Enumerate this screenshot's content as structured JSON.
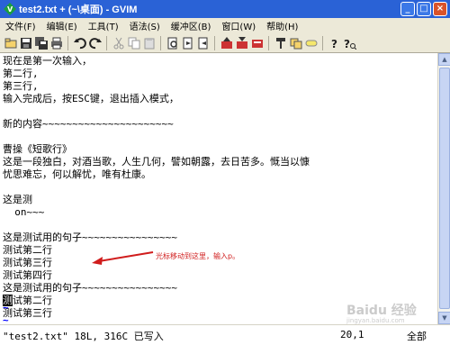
{
  "window": {
    "title": "test2.txt + (~\\桌面) - GVIM",
    "buttons": [
      "_",
      "□",
      "×"
    ]
  },
  "menu": {
    "items": [
      "文件(F)",
      "编辑(E)",
      "工具(T)",
      "语法(S)",
      "缓冲区(B)",
      "窗口(W)",
      "帮助(H)"
    ]
  },
  "toolbar": {
    "icons": [
      "open-icon",
      "save-icon",
      "save-all-icon",
      "print-icon",
      "undo-icon",
      "redo-icon",
      "cut-icon",
      "copy-icon",
      "paste-icon",
      "find-replace-icon",
      "find-next-icon",
      "find-prev-icon",
      "load-session-icon",
      "save-session-icon",
      "run-script-icon",
      "make-icon",
      "build-tags-icon",
      "jump-tag-icon",
      "help-icon",
      "find-help-icon"
    ]
  },
  "editor": {
    "lines": [
      "现在是第一次输入，",
      "第二行,",
      "第三行,",
      "输入完成后，按ESC键，退出插入模式，",
      "",
      "新的内容~~~~~~~~~~~~~~~~~~~~~~",
      "",
      "曹操《短歌行》",
      "这是一段独白，对酒当歌，人生几何，譬如朝露，去日苦多。慨当以慷",
      "忧思难忘，何以解忧，唯有杜康。",
      "",
      "这是测",
      "  on~~~",
      "",
      "这是测试用的句子~~~~~~~~~~~~~~~~",
      "测试第二行",
      "测试第三行",
      "测试第四行",
      "这是测试用的句子~~~~~~~~~~~~~~~~",
      "测试第二行",
      "测试第三行"
    ],
    "cursor_char": "测",
    "cursor_rest": "试第二行",
    "tildes": [
      "~",
      "~"
    ]
  },
  "annotation": {
    "text": "光标移动到这里，输入p。",
    "color": "#d01c1c"
  },
  "status": {
    "file_info": "\"test2.txt\" 18L, 316C 已写入",
    "position": "20,1",
    "scroll": "全部"
  },
  "watermark": {
    "text": "Baidu 经验",
    "sub": "jingyan.baidu.com"
  },
  "colors": {
    "titlebar": "#2a62d6",
    "menubar": "#ece9d8",
    "tilde": "#0000ff"
  }
}
